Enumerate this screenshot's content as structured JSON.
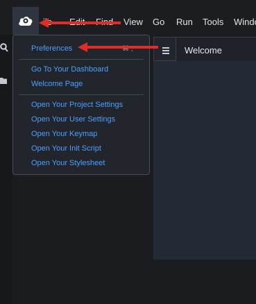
{
  "menubar": {
    "items": [
      "ile",
      "Edit",
      "Find",
      "View",
      "Go",
      "Run",
      "Tools",
      "Windo"
    ]
  },
  "dropdown": {
    "section1": [
      "Preferences"
    ],
    "preferences_shortcut": "⌘ ,",
    "section2": [
      "Go To Your Dashboard",
      "Welcome Page"
    ],
    "section3": [
      "Open Your Project Settings",
      "Open Your User Settings",
      "Open Your Keymap",
      "Open Your Init Script",
      "Open Your Stylesheet"
    ]
  },
  "tabs": {
    "active": "Welcome"
  },
  "icons": {
    "app": "cloud-icon",
    "search": "search-icon",
    "folder": "folder-icon",
    "menu": "hamburger-icon",
    "annotation": "red-arrow"
  },
  "colors": {
    "link": "#4aa0ff",
    "arrow": "#e12d26",
    "menubar": "#1c1d21",
    "dropdown": "#23252d",
    "editor": "#232a36"
  }
}
